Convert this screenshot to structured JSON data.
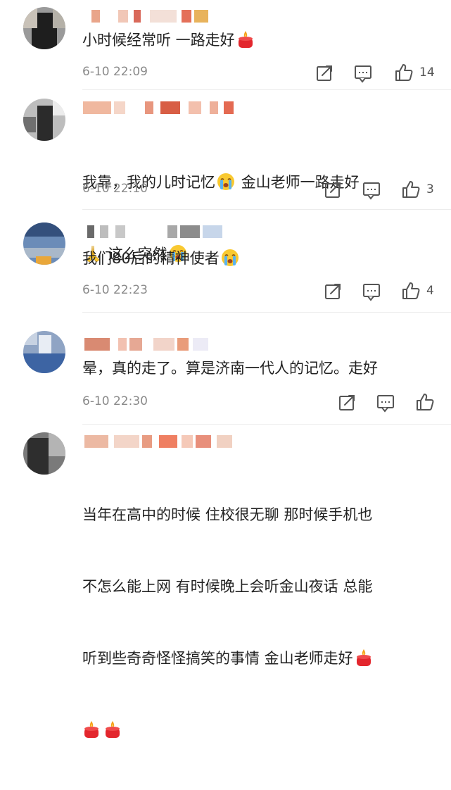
{
  "comments": [
    {
      "text": "小时候经常听 一路走好",
      "emoji_after": [
        "candle-emoji"
      ],
      "time": "6-10 22:09",
      "likes": "14"
    },
    {
      "text_line1": "我靠，我的儿时记忆",
      "text_line1b": "金山老师一路走好",
      "text_line2": "这么突然",
      "emoji_1": "crying-face-emoji",
      "emoji_2": "praying-hands-emoji",
      "emoji_3": "crying-face-emoji",
      "time": "6-10 22:10",
      "likes": "3"
    },
    {
      "text": "我们80后的精神使者",
      "emoji_after": [
        "crying-face-emoji"
      ],
      "time": "6-10 22:23",
      "likes": "4"
    },
    {
      "text": "晕，真的走了。算是济南一代人的记忆。走好",
      "time": "6-10 22:30",
      "likes": ""
    },
    {
      "line1": "当年在高中的时候 住校很无聊 那时候手机也",
      "line2": "不怎么能上网 有时候晚上会听金山夜话 总能",
      "line3": "听到些奇奇怪怪搞笑的事情 金山老师走好",
      "emoji_after": [
        "candle-emoji",
        "candle-emoji",
        "candle-emoji"
      ]
    }
  ],
  "icons": {
    "share": "share-icon",
    "reply": "comment-icon",
    "like": "thumbs-up-icon"
  },
  "colors": {
    "text": "#222222",
    "meta": "#8a8a8a",
    "icon": "#555555"
  }
}
